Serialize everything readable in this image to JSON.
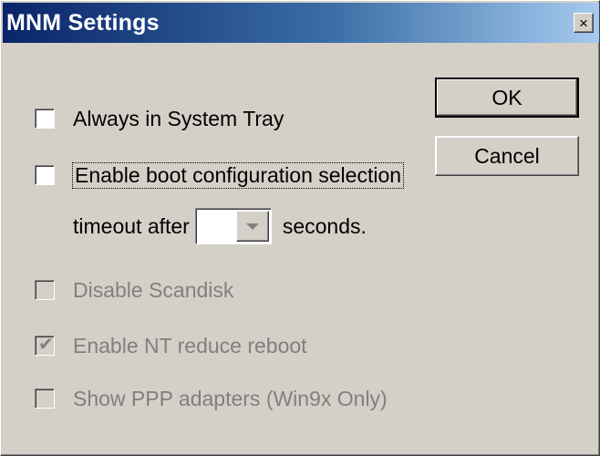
{
  "window": {
    "title": "MNM Settings",
    "close_glyph": "×"
  },
  "options": [
    {
      "label": "Always in System Tray",
      "checked": false,
      "disabled": false
    },
    {
      "label": "Enable boot configuration selection",
      "checked": false,
      "disabled": false,
      "focused": true
    },
    {
      "label": "Disable Scandisk",
      "checked": false,
      "disabled": true
    },
    {
      "label": "Enable NT reduce reboot",
      "checked": true,
      "disabled": true
    },
    {
      "label": "Show PPP adapters (Win9x Only)",
      "checked": false,
      "disabled": true
    }
  ],
  "timeout": {
    "prefix": "timeout after",
    "value": "",
    "suffix": "seconds."
  },
  "buttons": {
    "ok": "OK",
    "cancel": "Cancel"
  },
  "check_glyph": "✔"
}
